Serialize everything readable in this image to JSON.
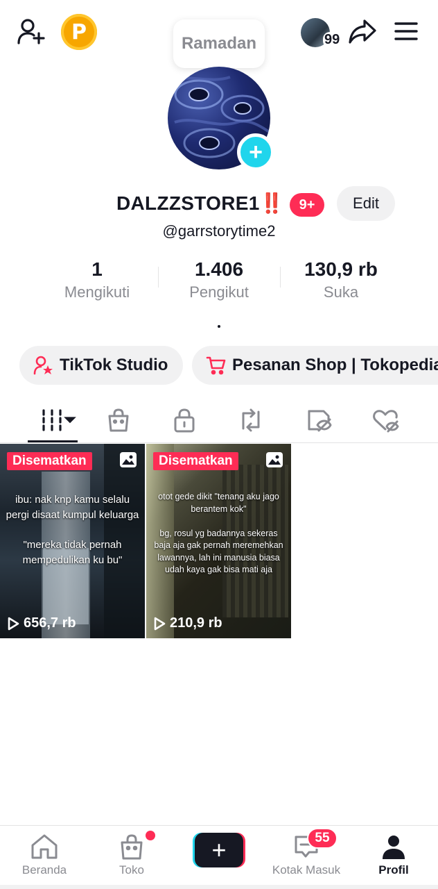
{
  "header": {
    "coin_letter": "P",
    "story_count": "99",
    "bubble_text": "Ramadan"
  },
  "profile": {
    "display_name": "DALZZSTORE1‼️",
    "notification_badge": "9+",
    "edit_label": "Edit",
    "handle": "@garrstorytime2",
    "bio": "."
  },
  "stats": [
    {
      "value": "1",
      "label": "Mengikuti"
    },
    {
      "value": "1.406",
      "label": "Pengikut"
    },
    {
      "value": "130,9 rb",
      "label": "Suka"
    }
  ],
  "shortcuts": {
    "studio_label": "TikTok Studio",
    "shop_label": "Pesanan Shop | Tokopedia"
  },
  "tabs": [
    "videos-grid",
    "shop",
    "private",
    "reposts",
    "hidden",
    "liked"
  ],
  "videos": [
    {
      "pin_label": "Disematkan",
      "caption": "ibu: nak knp kamu selalu pergi disaat kumpul keluarga\n\n\"mereka tidak pernah mempedulikan ku bu\"",
      "views": "656,7 rb"
    },
    {
      "pin_label": "Disematkan",
      "caption": "otot gede dikit \"tenang aku jago berantem kok\"\n\nbg, rosul yg badannya sekeras baja aja gak pernah meremehkan lawannya, lah ini manusia biasa udah kaya gak bisa mati aja",
      "views": "210,9 rb"
    }
  ],
  "bottom_nav": {
    "home": "Beranda",
    "shop": "Toko",
    "create": "+",
    "inbox": "Kotak Masuk",
    "inbox_badge": "55",
    "profile": "Profil"
  },
  "colors": {
    "accent_red": "#fe2c55",
    "accent_cyan": "#20d5ec",
    "text_primary": "#161823",
    "text_secondary": "#8a8b91"
  }
}
